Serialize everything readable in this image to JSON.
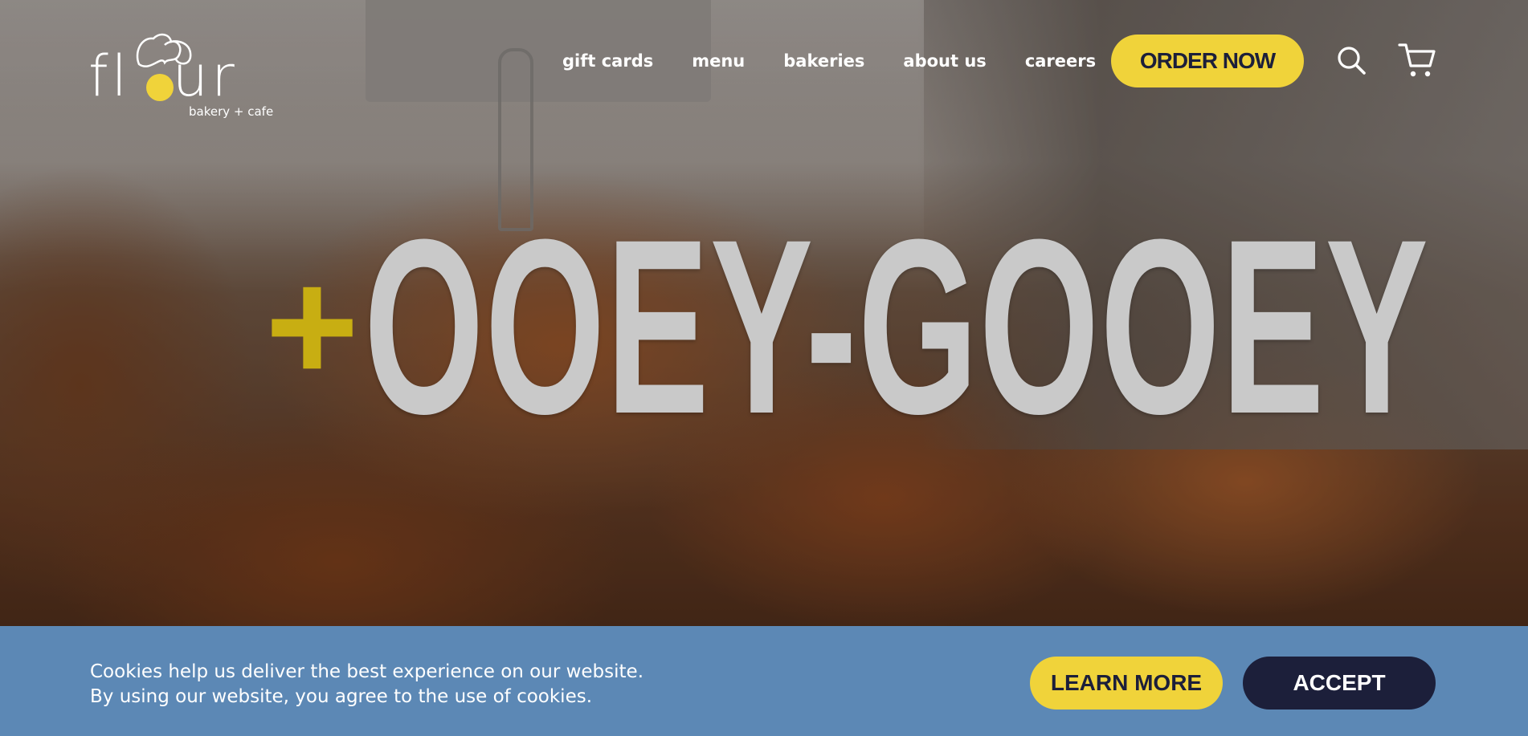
{
  "brand": {
    "logo_text": "fl  ur",
    "logo_sub": "bakery + cafe",
    "accent_color": "#f0d33a",
    "dark_color": "#1c1f3a"
  },
  "nav": {
    "items": [
      {
        "label": "gift cards"
      },
      {
        "label": "menu"
      },
      {
        "label": "bakeries"
      },
      {
        "label": "about us"
      },
      {
        "label": "careers"
      }
    ],
    "order_label": "ORDER NOW",
    "search_icon": "search-icon",
    "cart_icon": "cart-icon"
  },
  "hero": {
    "plus": "+",
    "headline": "OOEY-GOOEY"
  },
  "cookie": {
    "line1": "Cookies help us deliver the best experience on our website.",
    "line2": "By using our website, you agree to the use of cookies.",
    "learn_more": "LEARN MORE",
    "accept": "ACCEPT",
    "banner_color": "#5c88b5"
  }
}
